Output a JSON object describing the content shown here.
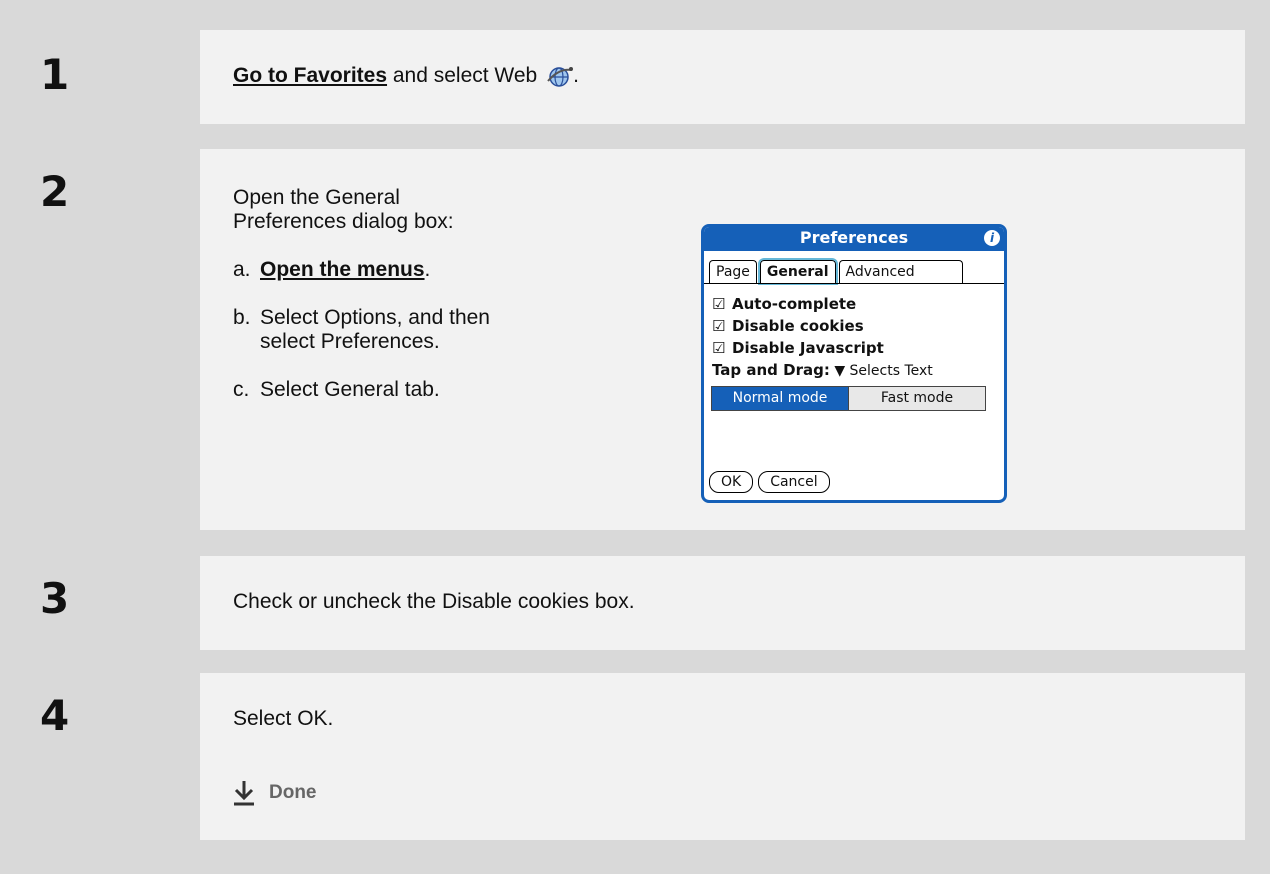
{
  "steps": [
    {
      "number": "1",
      "link": "Go to Favorites",
      "text": " and select Web ",
      "icon": "web-globe-icon",
      "after": "."
    },
    {
      "number": "2",
      "intro": "Open the General Preferences dialog box:",
      "substeps": [
        {
          "label": "a.",
          "link": "Open the menus",
          "after": "."
        },
        {
          "label": "b.",
          "text": "Select Options, and then select Preferences."
        },
        {
          "label": "c.",
          "text": "Select General tab."
        }
      ]
    },
    {
      "number": "3",
      "text": "Check or uncheck the Disable cookies box."
    },
    {
      "number": "4",
      "text": "Select OK.",
      "done": "Done"
    }
  ],
  "dialog": {
    "title": "Preferences",
    "tabs": [
      "Page",
      "General",
      "Advanced"
    ],
    "active_tab": "General",
    "options": [
      {
        "label": "Auto-complete",
        "checked": true
      },
      {
        "label": "Disable cookies",
        "checked": true
      },
      {
        "label": "Disable Javascript",
        "checked": true
      }
    ],
    "tap_drag_label": "Tap and Drag:",
    "tap_drag_value": "Selects Text",
    "modes": [
      "Normal mode",
      "Fast mode"
    ],
    "selected_mode": "Normal mode",
    "ok": "OK",
    "cancel": "Cancel"
  },
  "colors": {
    "accent": "#1560b8",
    "panel": "#f2f2f2",
    "background": "#d9d9d9"
  }
}
